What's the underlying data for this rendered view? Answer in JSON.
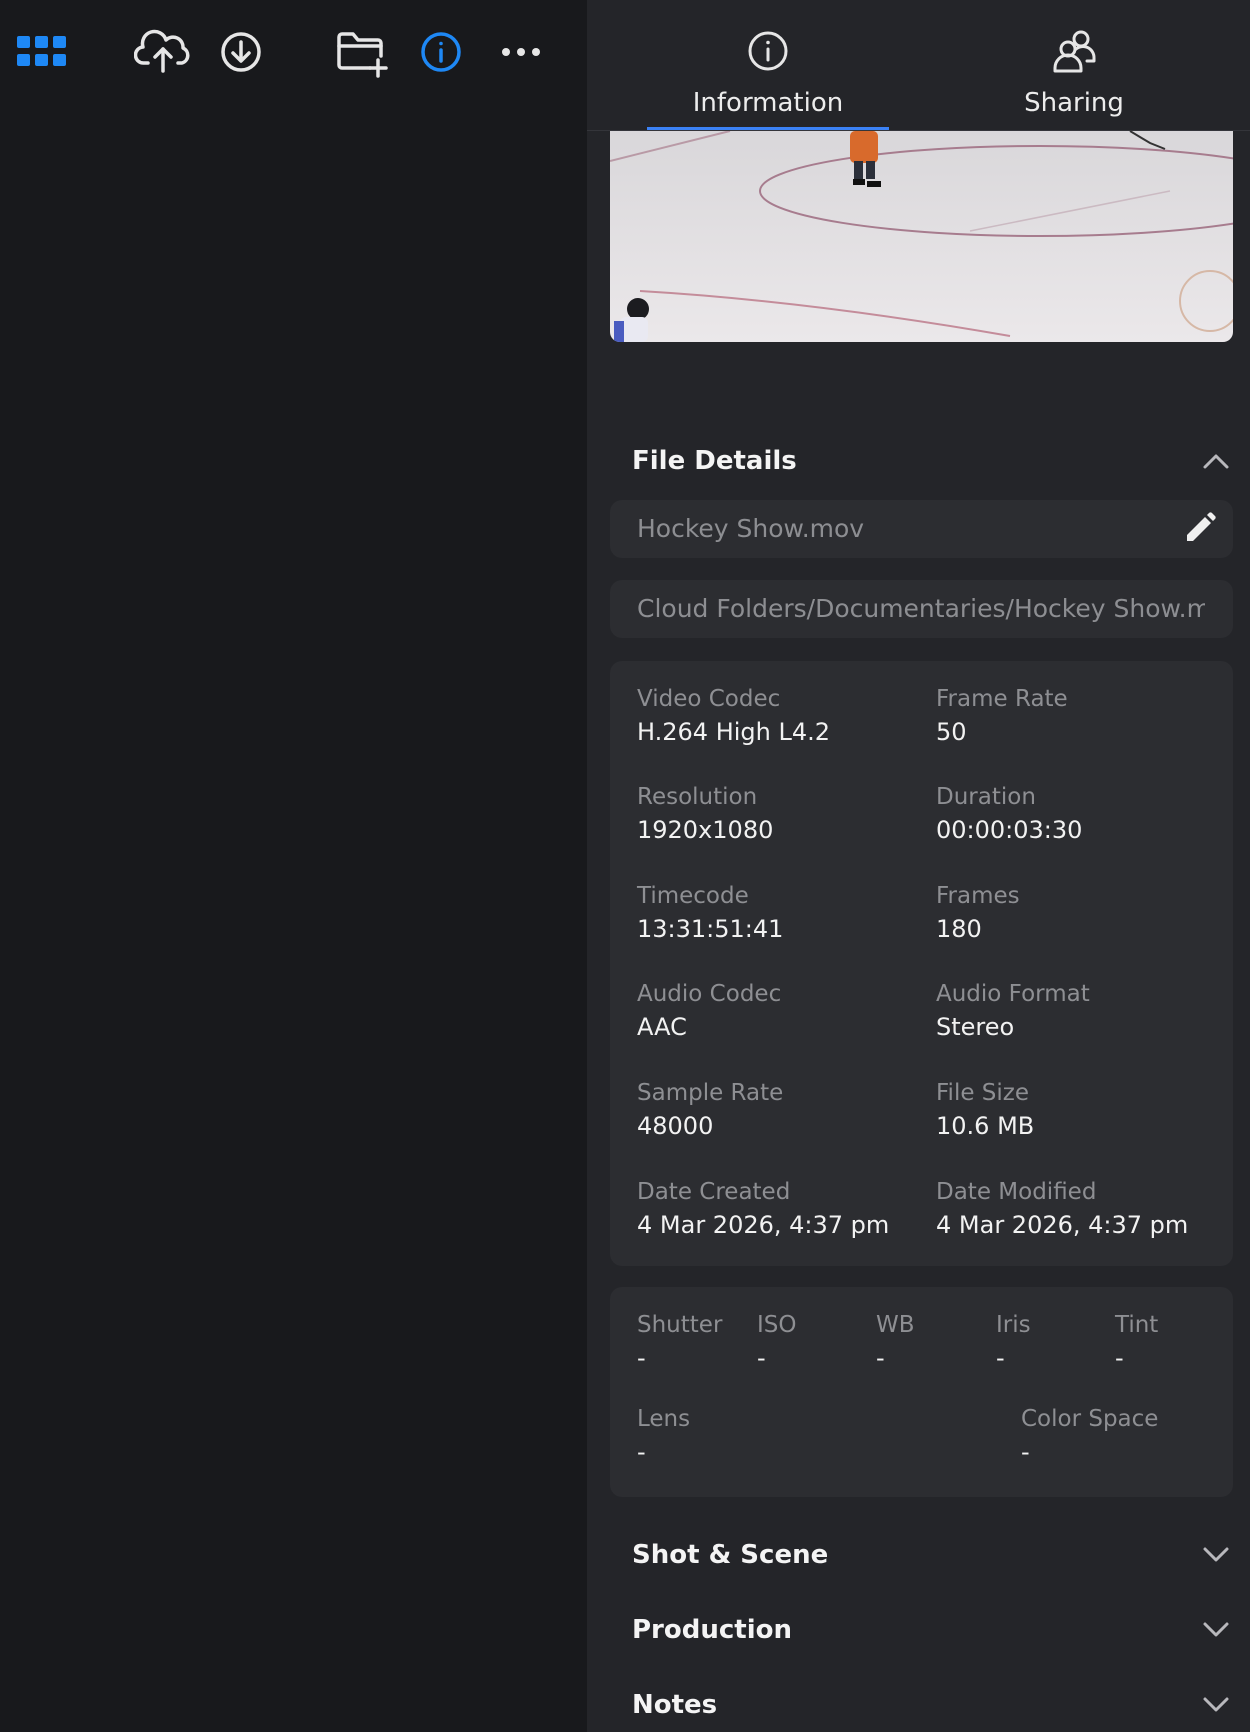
{
  "toolbar": {
    "icons": [
      "grid-icon",
      "cloud-upload-icon",
      "download-icon",
      "new-folder-icon",
      "info-icon",
      "more-icon"
    ],
    "accent_color": "#1e88f5"
  },
  "tabs": [
    {
      "label": "Information",
      "icon": "info-icon",
      "active": true
    },
    {
      "label": "Sharing",
      "icon": "people-icon",
      "active": false
    }
  ],
  "file_details": {
    "title": "File Details",
    "file_name": "Hockey Show.mov",
    "file_path": "Cloud Folders/Documentaries/Hockey Show.mov"
  },
  "metadata": [
    {
      "label": "Video Codec",
      "value": "H.264 High L4.2"
    },
    {
      "label": "Frame Rate",
      "value": "50"
    },
    {
      "label": "Resolution",
      "value": "1920x1080"
    },
    {
      "label": "Duration",
      "value": "00:00:03:30"
    },
    {
      "label": "Timecode",
      "value": "13:31:51:41"
    },
    {
      "label": "Frames",
      "value": "180"
    },
    {
      "label": "Audio Codec",
      "value": "AAC"
    },
    {
      "label": "Audio Format",
      "value": "Stereo"
    },
    {
      "label": "Sample Rate",
      "value": "48000"
    },
    {
      "label": "File Size",
      "value": "10.6 MB"
    },
    {
      "label": "Date Created",
      "value": "4 Mar 2026, 4:37 pm"
    },
    {
      "label": "Date Modified",
      "value": "4 Mar 2026, 4:37 pm"
    }
  ],
  "camera": [
    {
      "label": "Shutter",
      "value": "-"
    },
    {
      "label": "ISO",
      "value": "-"
    },
    {
      "label": "WB",
      "value": "-"
    },
    {
      "label": "Iris",
      "value": "-"
    },
    {
      "label": "Tint",
      "value": "-"
    },
    {
      "label": "Lens",
      "value": "-"
    },
    {
      "label": "Color Space",
      "value": "-"
    }
  ],
  "sections": [
    {
      "title": "Shot & Scene"
    },
    {
      "title": "Production"
    },
    {
      "title": "Notes"
    }
  ]
}
